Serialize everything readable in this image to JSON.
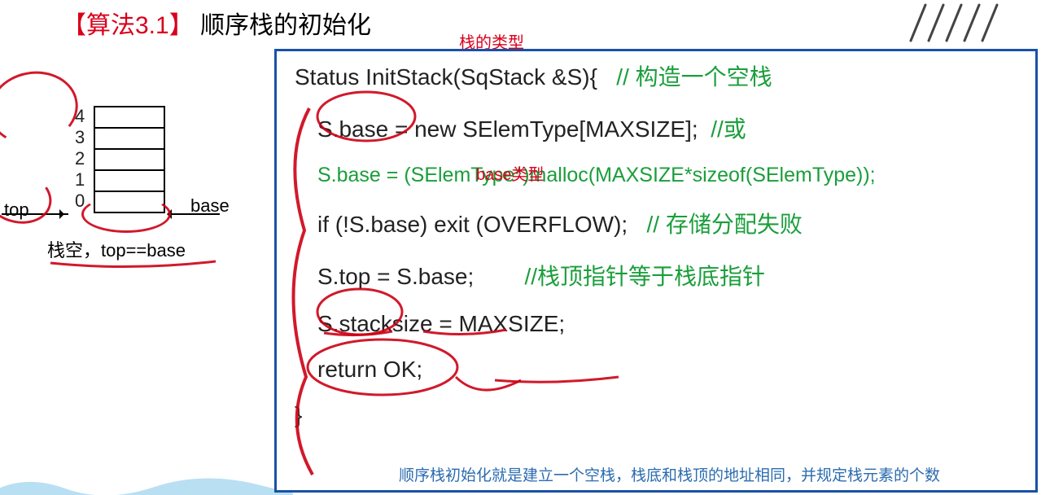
{
  "header": {
    "tag": "【算法3.1】",
    "title": "顺序栈的初始化"
  },
  "annotations": {
    "stack_type": "栈的类型",
    "base_type": "base类型",
    "summary": "顺序栈初始化就是建立一个空栈，栈底和栈顶的地址相同，并规定栈元素的个数"
  },
  "diagram": {
    "indices": [
      "0",
      "1",
      "2",
      "3",
      "4"
    ],
    "top_label": "top",
    "base_label": "base",
    "caption": "栈空，top==base"
  },
  "code": {
    "l1_a": "Status InitStack(SqStack   &S){",
    "l1_c": "// 构造一个空栈",
    "l2_a": "S.base = new SElemType[MAXSIZE];",
    "l2_c": "//或",
    "l3": "S.base = (SElemType*)malloc(MAXSIZE*sizeof(SElemType));",
    "l4_a": "if  (!S.base) exit  (OVERFLOW);",
    "l4_c": "// 存储分配失败",
    "l5_a": "S.top = S.base;",
    "l5_c": "//栈顶指针等于栈底指针",
    "l6": "S.stacksize = MAXSIZE;",
    "l7": "return OK;",
    "l8": "}"
  }
}
